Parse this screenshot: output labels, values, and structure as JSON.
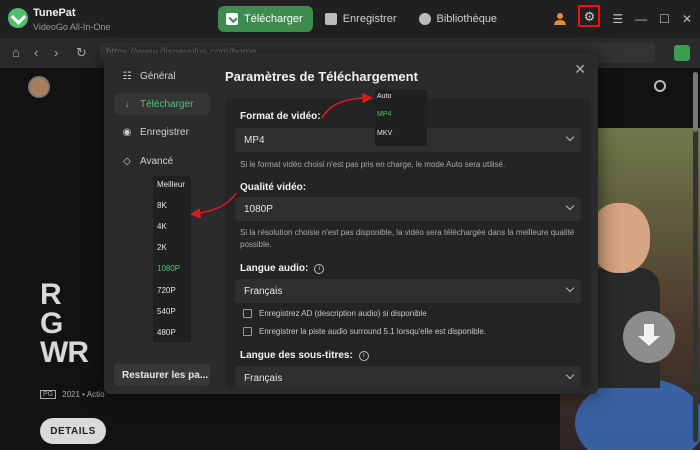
{
  "app": {
    "name": "TunePat",
    "subtitle": "VideoGo All-In-One"
  },
  "tabs": [
    {
      "label": "Télécharger",
      "icon": "download-icon",
      "active": true
    },
    {
      "label": "Enregistrer",
      "icon": "record-icon",
      "active": false
    },
    {
      "label": "Bibliothèque",
      "icon": "library-icon",
      "active": false
    }
  ],
  "addressbar": {
    "url": "https://www.disneyplus.com/home"
  },
  "background": {
    "title_letters": [
      "R",
      "G",
      "WR"
    ],
    "rating": "PG",
    "meta": "2021 • Actio",
    "details_label": "DETAILS"
  },
  "dialog": {
    "title": "Paramètres de Téléchargement",
    "sidebar": [
      {
        "label": "Général",
        "icon": "sliders-icon"
      },
      {
        "label": "Télécharger",
        "icon": "download-arrow-icon",
        "active": true
      },
      {
        "label": "Enregistrer",
        "icon": "eye-icon"
      },
      {
        "label": "Avancé",
        "icon": "diamond-icon"
      }
    ],
    "restore_label": "Restaurer les pa..."
  },
  "settings": {
    "video_format": {
      "label": "Format de vidéo:",
      "value": "MP4",
      "note": "Si le format vidéo choisi n'est pas pris en charge, le mode Auto sera utilisé.",
      "options": [
        "Auto",
        "MP4",
        "MKV"
      ],
      "selected": "MP4"
    },
    "video_quality": {
      "label": "Qualité vidéo:",
      "value": "1080P",
      "note": "Si la résolution choisie n'est pas disponible, la vidéo sera téléchargée dans la meilleure qualité possible.",
      "options": [
        "Meilleur",
        "8K",
        "4K",
        "2K",
        "1080P",
        "720P",
        "540P",
        "480P"
      ],
      "selected": "1080P"
    },
    "audio_language": {
      "label": "Langue audio:",
      "value": "Français",
      "checkbox_ad": "Enregistrez AD (description audio) si disponible",
      "checkbox_surround": "Enregistrer la piste audio surround 5.1 lorsqu'elle est disponible."
    },
    "subtitle_language": {
      "label": "Langue des sous-titres:",
      "value": "Français"
    }
  },
  "colors": {
    "accent": "#3d8b4f",
    "highlight": "#e11111",
    "selected_text": "#4fc46a"
  }
}
